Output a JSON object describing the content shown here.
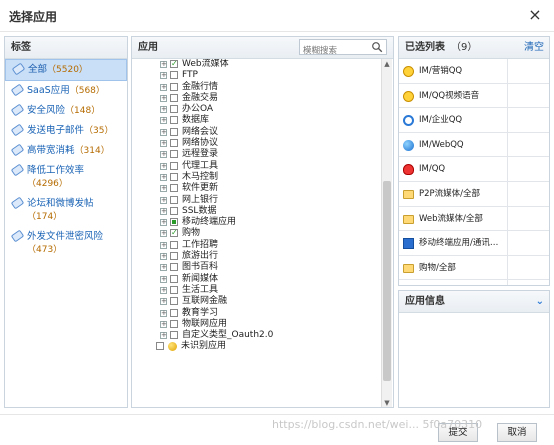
{
  "dialog": {
    "title": "选择应用",
    "close_glyph": "×"
  },
  "tags": {
    "header": "标签",
    "items": [
      {
        "label": "全部",
        "count": "（5520）",
        "selected": true
      },
      {
        "label": "SaaS应用",
        "count": "（568）"
      },
      {
        "label": "安全风险",
        "count": "（148）"
      },
      {
        "label": "发送电子邮件",
        "count": "（35）"
      },
      {
        "label": "高带宽消耗",
        "count": "（314）"
      },
      {
        "label": "降低工作效率",
        "count": "（4296）"
      },
      {
        "label": "论坛和微博发帖",
        "count": "（174）"
      },
      {
        "label": "外发文件泄密风险",
        "count": "（473）"
      }
    ]
  },
  "apps": {
    "header": "应用",
    "search_placeholder": "模糊搜索",
    "rows": [
      {
        "label": "Web流媒体",
        "state": "checked"
      },
      {
        "label": "FTP",
        "state": "none"
      },
      {
        "label": "金融行情",
        "state": "none"
      },
      {
        "label": "金融交易",
        "state": "none"
      },
      {
        "label": "办公OA",
        "state": "none"
      },
      {
        "label": "数据库",
        "state": "none"
      },
      {
        "label": "网络会议",
        "state": "none"
      },
      {
        "label": "网络协议",
        "state": "none"
      },
      {
        "label": "远程登录",
        "state": "none"
      },
      {
        "label": "代理工具",
        "state": "none"
      },
      {
        "label": "木马控制",
        "state": "none"
      },
      {
        "label": "软件更新",
        "state": "none"
      },
      {
        "label": "网上银行",
        "state": "none"
      },
      {
        "label": "SSL数据",
        "state": "none"
      },
      {
        "label": "移动终端应用",
        "state": "partial"
      },
      {
        "label": "购物",
        "state": "checked"
      },
      {
        "label": "工作招聘",
        "state": "none"
      },
      {
        "label": "旅游出行",
        "state": "none"
      },
      {
        "label": "图书百科",
        "state": "none"
      },
      {
        "label": "新闻媒体",
        "state": "none"
      },
      {
        "label": "生活工具",
        "state": "none"
      },
      {
        "label": "互联网金融",
        "state": "none"
      },
      {
        "label": "教育学习",
        "state": "none"
      },
      {
        "label": "物联网应用",
        "state": "none"
      },
      {
        "label": "自定义类型_Oauth2.0",
        "state": "none"
      }
    ],
    "unidentified": "未识别应用"
  },
  "selected": {
    "header": "已选列表",
    "count": "（9）",
    "clear": "清空",
    "items": [
      {
        "label": "IM/营销QQ",
        "icon": "qq-icon"
      },
      {
        "label": "IM/QQ视频语音",
        "icon": "qq-icon"
      },
      {
        "label": "IM/企业QQ",
        "icon": "enterprise-qq-icon"
      },
      {
        "label": "IM/WebQQ",
        "icon": "webqq-icon"
      },
      {
        "label": "IM/QQ",
        "icon": "qq-red-icon"
      },
      {
        "label": "P2P流媒体/全部",
        "icon": "folder-icon"
      },
      {
        "label": "Web流媒体/全部",
        "icon": "folder-icon"
      },
      {
        "label": "移动终端应用/通讯…",
        "icon": "mobile-icon"
      },
      {
        "label": "购物/全部",
        "icon": "folder-icon"
      }
    ]
  },
  "info": {
    "header": "应用信息"
  },
  "footer": {
    "submit": "提交",
    "cancel": "取消"
  },
  "watermark": "https://blog.csdn.net/wei... 5f0a70310"
}
